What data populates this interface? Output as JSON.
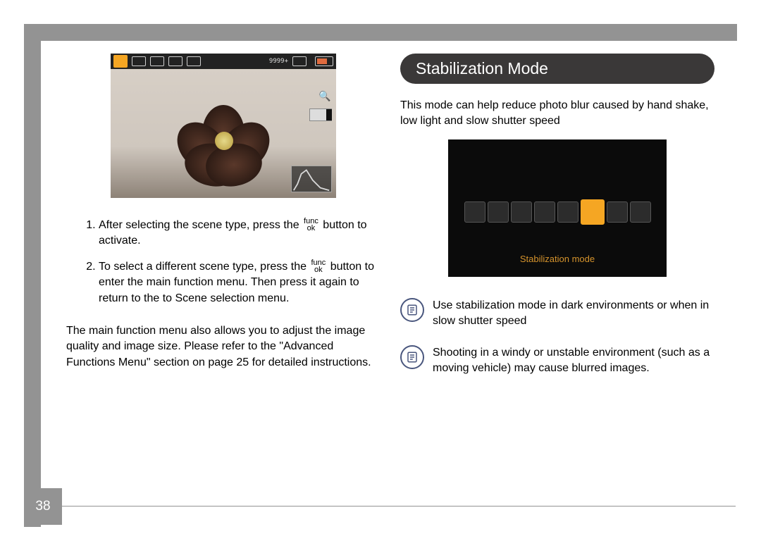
{
  "page_number": "38",
  "left": {
    "camshot_topbar_count": "9999+",
    "steps": [
      {
        "pre": "After selecting the scene type, press the ",
        "post": " button to activate."
      },
      {
        "pre": "To select a different scene type, press the ",
        "post": " button to enter the main function menu. Then press it again to return to the to Scene selection menu."
      }
    ],
    "func_label_top": "func",
    "func_label_bottom": "ok",
    "body": "The main function menu also allows you to adjust the image quality and image size. Please refer to the \"Advanced Functions Menu\" section on page 25 for detailed instructions."
  },
  "right": {
    "heading": "Stabilization Mode",
    "intro": "This mode can help reduce photo blur caused by hand shake, low light and slow shutter speed",
    "mode_label": "Stabilization mode",
    "notes": [
      "Use stabilization mode in dark environments or when in slow shutter speed",
      "Shooting in a windy or unstable environment (such as a moving vehicle) may cause blurred images."
    ]
  }
}
